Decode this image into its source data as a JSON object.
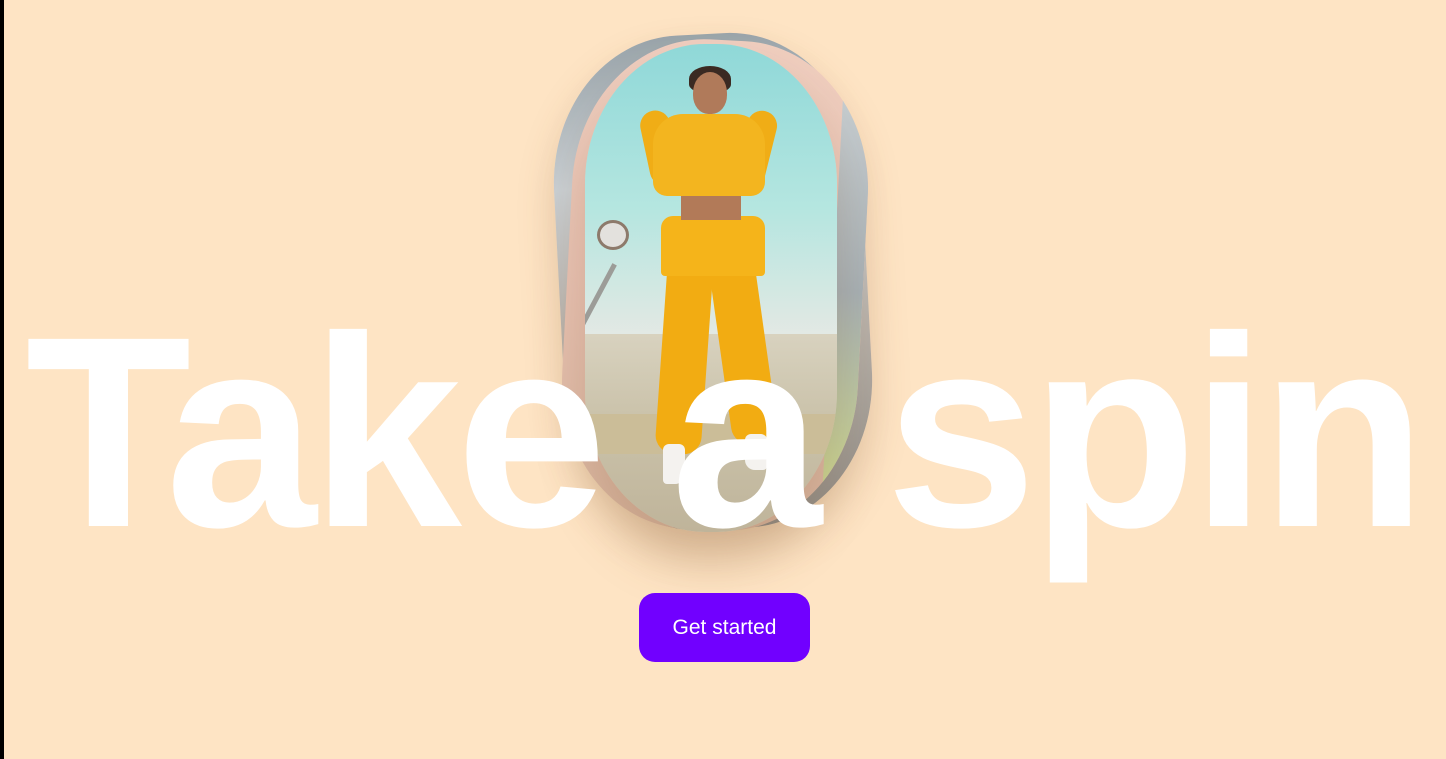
{
  "hero": {
    "headline": "Take a spin",
    "cta_label": "Get started"
  },
  "colors": {
    "background": "#fee4c4",
    "headline": "#ffffff",
    "cta_background": "#7100ff",
    "cta_text": "#ffffff"
  },
  "media": {
    "card_count": 3,
    "front_card_subject": "person-in-yellow-tracksuit-on-basketball-court"
  }
}
